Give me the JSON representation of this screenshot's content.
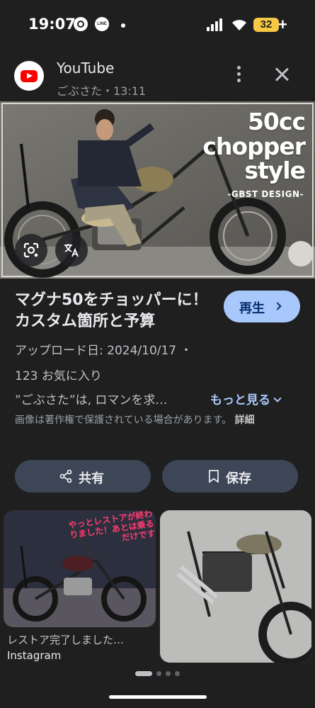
{
  "status_bar": {
    "time": "19:07",
    "line_label": "LINE",
    "battery": "32",
    "plus": "+"
  },
  "header": {
    "source": "YouTube",
    "meta": "ごぶさた・13:11"
  },
  "hero": {
    "title_line1": "50cc",
    "title_line2": "chopper",
    "title_line3": "style",
    "subtitle": "-GBST DESIGN-"
  },
  "info": {
    "title": "マグナ50をチョッパーに！カスタム箇所と予算",
    "play_label": "再生",
    "upload_date": "アップロード日: 2024/10/17 ・",
    "favorites": "123 お気に入り",
    "description": "”ごぶさた”は, ロマンを求…",
    "more_label": "もっと見る",
    "copyright": "画像は著作権で保護されている場合があります。",
    "details_label": "詳細"
  },
  "actions": {
    "share_label": "共有",
    "save_label": "保存"
  },
  "related": [
    {
      "caption": "レストア完了しました…",
      "source": "Instagram",
      "overlay_text": "やっとレストアが終わりました！あとは乗るだけです"
    }
  ],
  "colors": {
    "background": "#1f1f1f",
    "accent_button": "#a8c7fa",
    "action_button": "#3c4656",
    "battery": "#f7c843"
  },
  "icons": [
    "chrome-icon",
    "line-icon",
    "signal-icon",
    "wifi-icon",
    "battery-icon",
    "youtube-icon",
    "more-vert-icon",
    "close-icon",
    "lens-icon",
    "translate-icon",
    "share-icon",
    "bookmark-icon",
    "chevron-right-icon",
    "chevron-down-icon"
  ]
}
